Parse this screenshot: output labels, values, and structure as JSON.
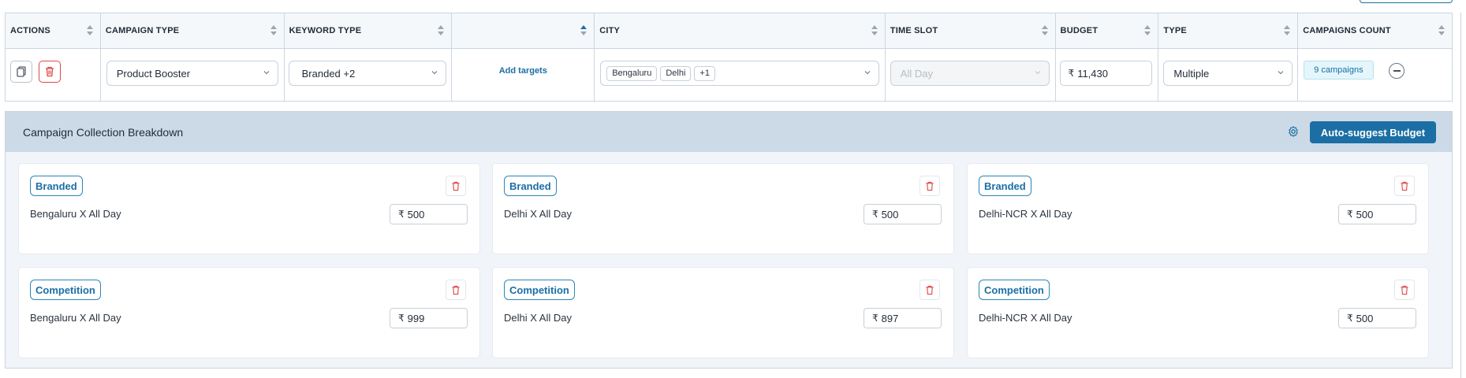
{
  "table": {
    "headers": [
      {
        "label": "ACTIONS"
      },
      {
        "label": "CAMPAIGN TYPE"
      },
      {
        "label": "KEYWORD TYPE"
      },
      {
        "label": ""
      },
      {
        "label": "CITY"
      },
      {
        "label": "TIME SLOT"
      },
      {
        "label": "BUDGET"
      },
      {
        "label": "TYPE"
      },
      {
        "label": "CAMPAIGNS COUNT"
      }
    ],
    "row": {
      "campaign_type": "Product Booster",
      "keyword_type": "Branded +2",
      "add_targets": "Add targets",
      "cities": [
        "Bengaluru",
        "Delhi",
        "+1"
      ],
      "time_slot": "All Day",
      "budget_currency": "₹",
      "budget": "11,430",
      "type": "Multiple",
      "campaigns_count": "9 campaigns"
    }
  },
  "breakdown": {
    "title": "Campaign Collection Breakdown",
    "auto_suggest_label": "Auto-suggest Budget",
    "currency": "₹",
    "cards": [
      {
        "tag": "Branded",
        "label": "Bengaluru X All Day",
        "value": "500"
      },
      {
        "tag": "Branded",
        "label": "Delhi X All Day",
        "value": "500"
      },
      {
        "tag": "Branded",
        "label": "Delhi-NCR X All Day",
        "value": "500"
      },
      {
        "tag": "Competition",
        "label": "Bengaluru X All Day",
        "value": "999"
      },
      {
        "tag": "Competition",
        "label": "Delhi X All Day",
        "value": "897"
      },
      {
        "tag": "Competition",
        "label": "Delhi-NCR X All Day",
        "value": "500"
      }
    ]
  },
  "colors": {
    "accent": "#1b6fa4",
    "danger": "#e04646",
    "panel_header": "#ccdae7",
    "badge_bg": "#e4f6fb"
  },
  "icons": {
    "copy": "copy-icon",
    "delete": "trash-icon",
    "chevron": "chevron-down-icon",
    "settings": "gear-icon",
    "collapse": "minus-circle-icon"
  }
}
